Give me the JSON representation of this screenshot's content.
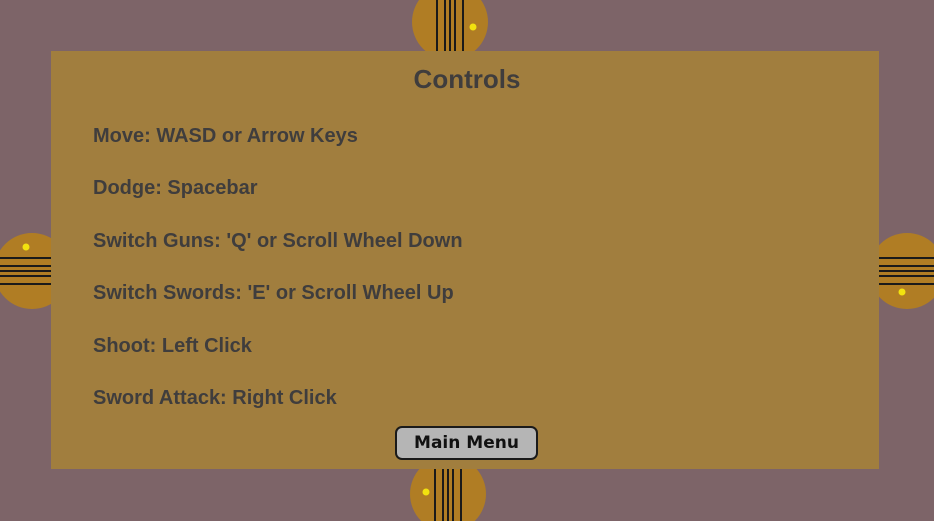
{
  "screen": {
    "title": "Controls"
  },
  "controls": [
    {
      "text": "Move: WASD or Arrow Keys"
    },
    {
      "text": "Dodge: Spacebar"
    },
    {
      "text": "Switch Guns: 'Q' or Scroll Wheel Down"
    },
    {
      "text": "Switch Swords: 'E' or Scroll Wheel Up"
    },
    {
      "text": "Shoot: Left Click"
    },
    {
      "text": "Sword Attack: Right Click"
    }
  ],
  "buttons": {
    "main_menu": "Main Menu"
  },
  "colors": {
    "background": "#7d6468",
    "panel": "#a17e3e",
    "door_wood": "#b07d24",
    "door_plank_line": "#1a1a1a",
    "door_knob": "#f2e20f",
    "text": "#3f3d3d",
    "button_fill": "#b5b5b5"
  },
  "doors": [
    {
      "name": "door-top",
      "orientation": "vertical-planks"
    },
    {
      "name": "door-bottom",
      "orientation": "vertical-planks"
    },
    {
      "name": "door-left",
      "orientation": "horizontal-planks"
    },
    {
      "name": "door-right",
      "orientation": "horizontal-planks"
    }
  ]
}
